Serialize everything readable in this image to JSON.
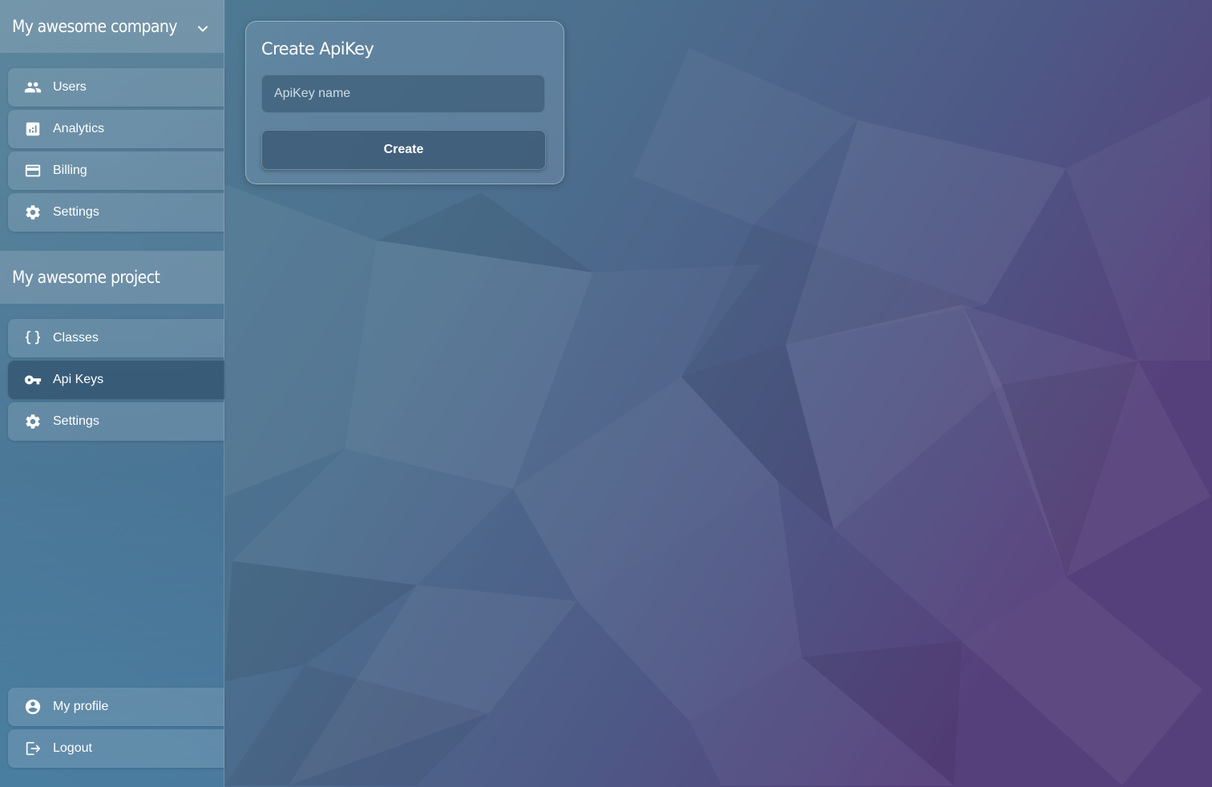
{
  "sidebar": {
    "company": {
      "name": "My awesome company",
      "chevron_icon": "chevron-down-icon",
      "items": [
        {
          "label": "Users",
          "icon": "users-icon"
        },
        {
          "label": "Analytics",
          "icon": "analytics-icon"
        },
        {
          "label": "Billing",
          "icon": "credit-card-icon"
        },
        {
          "label": "Settings",
          "icon": "gear-icon"
        }
      ]
    },
    "project": {
      "name": "My awesome project",
      "items": [
        {
          "label": "Classes",
          "icon": "curly-braces-icon"
        },
        {
          "label": "Api Keys",
          "icon": "key-icon",
          "active": true
        },
        {
          "label": "Settings",
          "icon": "gear-icon"
        }
      ]
    },
    "footer": {
      "items": [
        {
          "label": "My profile",
          "icon": "account-circle-icon"
        },
        {
          "label": "Logout",
          "icon": "logout-icon"
        }
      ]
    }
  },
  "create_apikey": {
    "title": "Create ApiKey",
    "input_placeholder": "ApiKey name",
    "input_value": "",
    "button_label": "Create"
  },
  "colors": {
    "text": "#ffffff",
    "active_item_bg": "#2f4a60",
    "bg_left": "#4f7f96",
    "bg_right": "#553f7a"
  }
}
